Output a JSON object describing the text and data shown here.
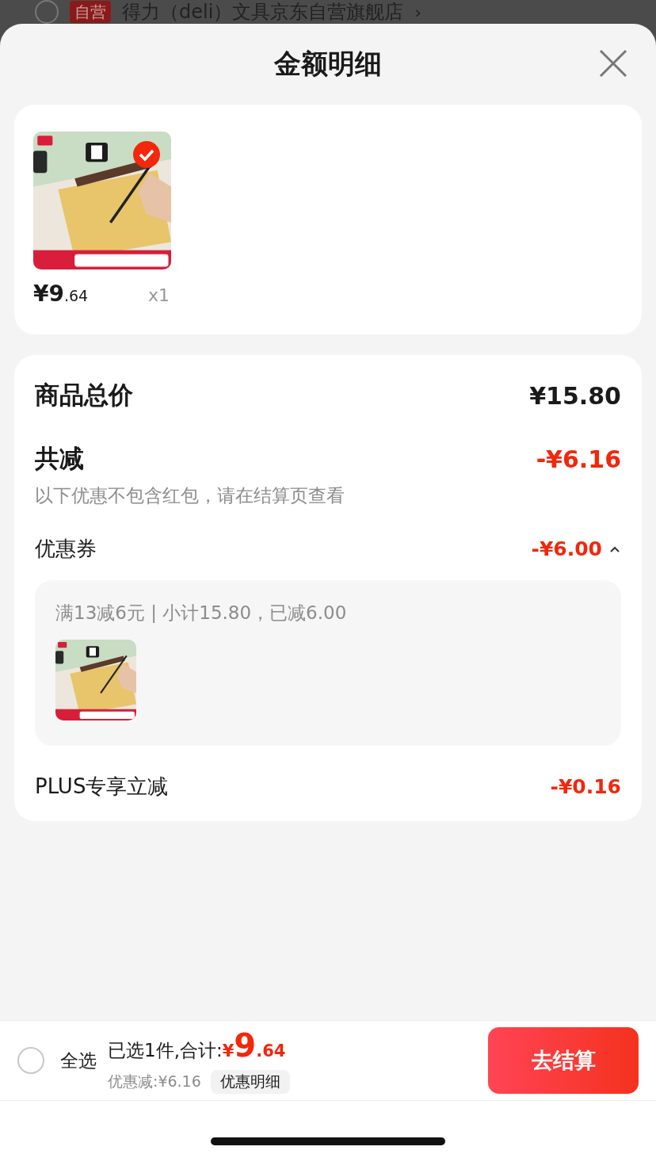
{
  "background": {
    "checkbox_checked": false,
    "badge": "自营",
    "store": "得力（deli）文具京东自营旗舰店",
    "chevron": "›"
  },
  "title": "金额明细",
  "product": {
    "selected": true,
    "price_symbol": "¥",
    "price_int": "9",
    "price_dec": ".64",
    "quantity": "x1"
  },
  "summary": {
    "total_label": "商品总价",
    "total": "¥15.80",
    "discount_label": "共减",
    "discount": "-¥6.16",
    "note": "以下优惠不包含红包，请在结算页查看"
  },
  "coupon": {
    "label": "优惠券",
    "amount": "-¥6.00",
    "expanded": true,
    "detail": "满13减6元 | 小计15.80，已减6.00"
  },
  "plus": {
    "label": "PLUS专享立减",
    "amount": "-¥0.16"
  },
  "footer": {
    "select_all_checked": false,
    "select_all": "全选",
    "selected_text": "已选1件,合计:",
    "price_symbol": "¥",
    "price_int": "9",
    "price_dec": ".64",
    "saved": "优惠减:¥6.16",
    "details_button": "优惠明细",
    "checkout": "去结算"
  }
}
